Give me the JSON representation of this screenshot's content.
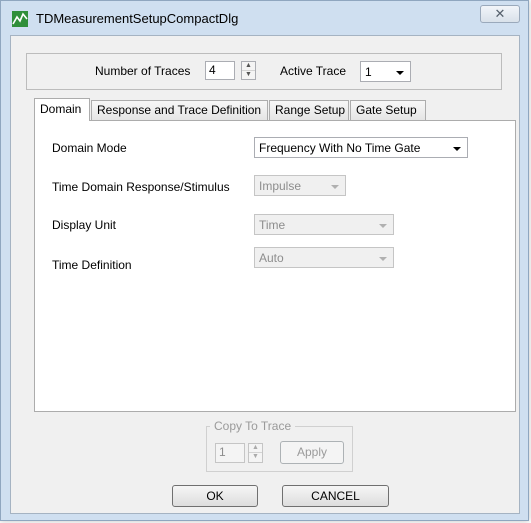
{
  "window": {
    "title": "TDMeasurementSetupCompactDlg",
    "close_glyph": "✕"
  },
  "header": {
    "num_traces_label": "Number of Traces",
    "num_traces_value": "4",
    "active_trace_label": "Active Trace",
    "active_trace_value": "1"
  },
  "tabs": [
    "Domain",
    "Response and Trace Definition",
    "Range Setup",
    "Gate Setup"
  ],
  "domain": {
    "domain_mode_label": "Domain Mode",
    "domain_mode_value": "Frequency With No Time Gate",
    "response_label": "Time Domain Response/Stimulus",
    "response_value": "Impulse",
    "display_unit_label": "Display Unit",
    "display_unit_value": "Time",
    "time_def_label": "Time Definition",
    "time_def_value": "Auto"
  },
  "copy": {
    "group_title": "Copy To Trace",
    "trace_value": "1",
    "apply_label": "Apply"
  },
  "buttons": {
    "ok": "OK",
    "cancel": "CANCEL"
  },
  "icons": {
    "app": "measurement-app-icon",
    "close": "close-icon",
    "spin": "spin-up-down-icon",
    "dropdown": "chevron-down-icon"
  }
}
